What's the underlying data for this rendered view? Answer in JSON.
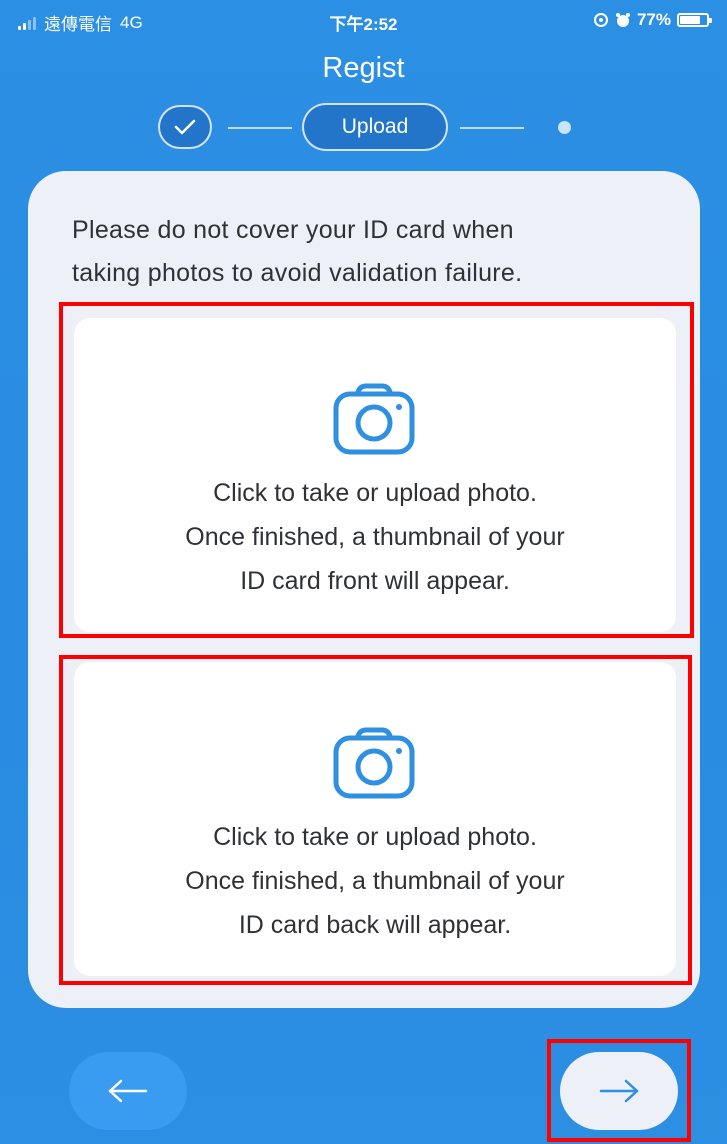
{
  "status_bar": {
    "carrier": "遠傳電信",
    "network": "4G",
    "time": "下午2:52",
    "battery": "77%",
    "battery_level": 0.77
  },
  "header": {
    "title": "Regist",
    "steps": [
      {
        "state": "completed",
        "icon": "check-icon"
      },
      {
        "state": "current",
        "label": "Upload"
      },
      {
        "state": "upcoming"
      }
    ]
  },
  "instructions": {
    "line1": "Please do not cover your ID card when",
    "line2": "taking photos to avoid validation failure."
  },
  "upload_front": {
    "icon": "camera-icon",
    "line1": "Click to take or upload photo.",
    "line2": "Once finished, a thumbnail of your",
    "line3": "ID card front will appear."
  },
  "upload_back": {
    "icon": "camera-icon",
    "line1": "Click to take or upload photo.",
    "line2": "Once finished, a thumbnail of your",
    "line3": "ID card back will appear."
  },
  "navigation": {
    "back_icon": "arrow-left-icon",
    "next_icon": "arrow-right-icon"
  },
  "colors": {
    "background": "#2a8ce0",
    "card": "#edf0f6",
    "icon_blue": "#2f8fe0",
    "highlight": "#ff0000"
  }
}
